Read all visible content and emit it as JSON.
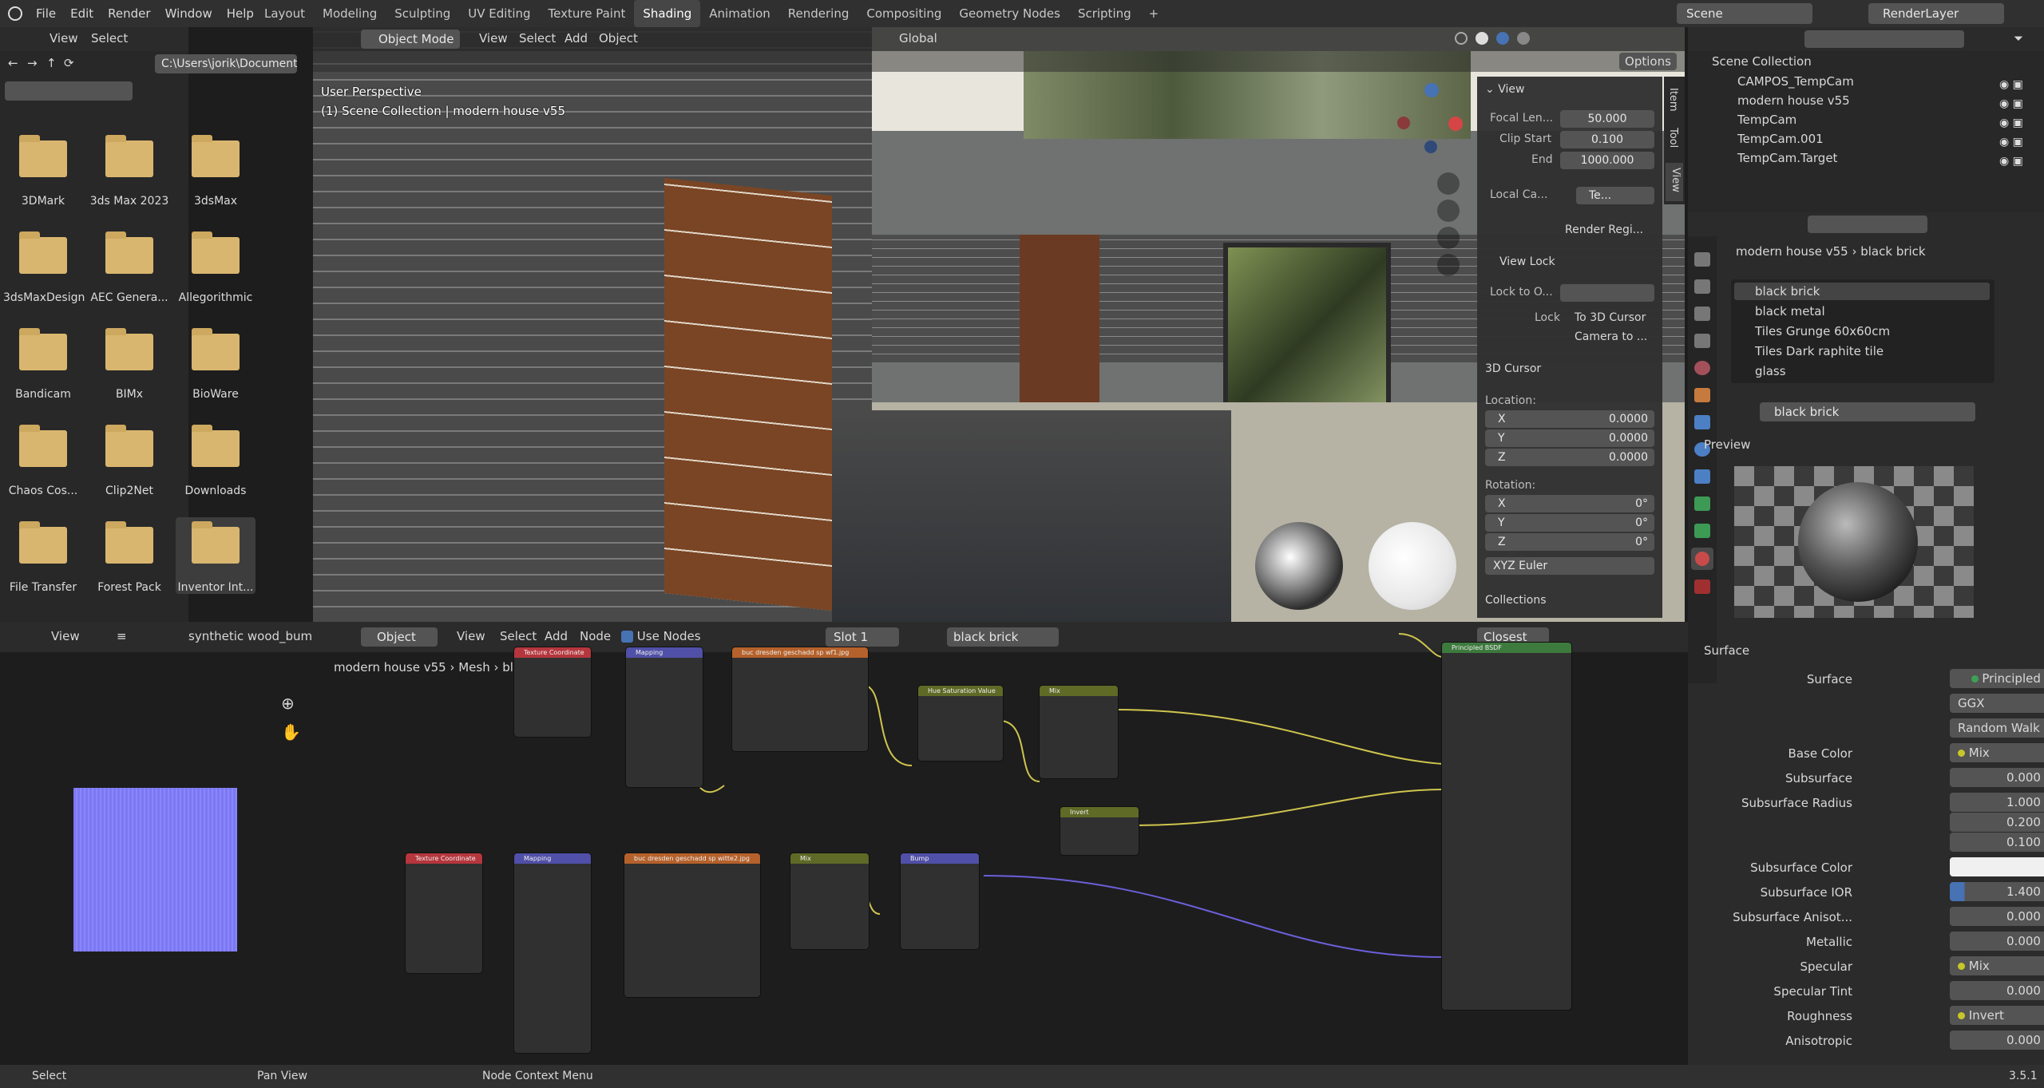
{
  "menubar": {
    "items": [
      "File",
      "Edit",
      "Render",
      "Window",
      "Help"
    ],
    "workspaces": [
      "Layout",
      "Modeling",
      "Sculpting",
      "UV Editing",
      "Texture Paint",
      "Shading",
      "Animation",
      "Rendering",
      "Compositing",
      "Geometry Nodes",
      "Scripting"
    ],
    "active_workspace": "Shading",
    "add": "+",
    "scene": "Scene",
    "view_layer": "RenderLayer"
  },
  "filebrowser": {
    "menu": [
      "View",
      "Select"
    ],
    "path": "C:\\Users\\jorik\\Documents\\",
    "folders": [
      "3DMark",
      "3ds Max 2023",
      "3dsMax",
      "3dsMaxDesign",
      "AEC Genera...",
      "Allegorithmic",
      "Bandicam",
      "BIMx",
      "BioWare",
      "Chaos Cos...",
      "Clip2Net",
      "Downloads",
      "File Transfer",
      "Forest Pack",
      "Inventor Int..."
    ]
  },
  "viewport": {
    "mode": "Object Mode",
    "menu": [
      "View",
      "Select",
      "Add",
      "Object"
    ],
    "transform": "Global",
    "options": "Options",
    "overlay_line1": "User Perspective",
    "overlay_line2": "(1) Scene Collection | modern house v55"
  },
  "npanel": {
    "tabs": [
      "Item",
      "Tool",
      "View"
    ],
    "view_title": "View",
    "focal_label": "Focal Len...",
    "focal": "50.000",
    "clip_start_label": "Clip Start",
    "clip_start": "0.100",
    "end_label": "End",
    "end": "1000.000",
    "local_cam": "Local Ca...",
    "local_cam_field": "Te...",
    "render_region": "Render Regi...",
    "view_lock": "View Lock",
    "lock_to": "Lock to O...",
    "lock": "Lock",
    "to_3d_cursor": "To 3D Cursor",
    "camera_to": "Camera to ...",
    "cursor_title": "3D Cursor",
    "location": "Location:",
    "loc": [
      [
        "X",
        "0.0000"
      ],
      [
        "Y",
        "0.0000"
      ],
      [
        "Z",
        "0.0000"
      ]
    ],
    "rotation": "Rotation:",
    "rot": [
      [
        "X",
        "0°"
      ],
      [
        "Y",
        "0°"
      ],
      [
        "Z",
        "0°"
      ]
    ],
    "euler": "XYZ Euler",
    "collections": "Collections"
  },
  "outliner": {
    "root": "Scene Collection",
    "items": [
      "CAMPOS_TempCam",
      "modern house v55",
      "TempCam",
      "TempCam.001",
      "TempCam.Target"
    ]
  },
  "properties": {
    "breadcrumb_obj": "modern house v55",
    "breadcrumb_mat": "black brick",
    "materials": [
      "black brick",
      "black metal",
      "Tiles Grunge 60x60cm",
      "Tiles Dark raphite tile",
      "glass"
    ],
    "material_name": "black brick",
    "preview": "Preview",
    "surface_panel": "Surface",
    "rows": [
      [
        "Surface",
        "Principled BSDF"
      ],
      [
        "",
        "GGX"
      ],
      [
        "",
        "Random Walk"
      ],
      [
        "Base Color",
        "Mix"
      ],
      [
        "Subsurface",
        "0.000"
      ],
      [
        "Subsurface Radius",
        "1.000"
      ],
      [
        "",
        "0.200"
      ],
      [
        "",
        "0.100"
      ],
      [
        "Subsurface Color",
        ""
      ],
      [
        "Subsurface IOR",
        "1.400"
      ],
      [
        "Subsurface Anisot...",
        "0.000"
      ],
      [
        "Metallic",
        "0.000"
      ],
      [
        "Specular",
        "Mix"
      ],
      [
        "Specular Tint",
        "0.000"
      ],
      [
        "Roughness",
        "Invert"
      ],
      [
        "Anisotropic",
        "0.000"
      ]
    ]
  },
  "image_editor": {
    "menu": [
      "View"
    ],
    "image": "synthetic wood_bump.p"
  },
  "node_editor": {
    "type": "Object",
    "menu": [
      "View",
      "Select",
      "Add",
      "Node"
    ],
    "use_nodes": "Use Nodes",
    "slot": "Slot 1",
    "material": "black brick",
    "breadcrumb": [
      "modern house v55",
      "Mesh",
      "black brick"
    ],
    "interp": "Closest",
    "nodes": {
      "texcoord": "Texture Coordinate",
      "mapping": "Mapping",
      "img1": "buc dresden geschadd sp wf1.jpg",
      "img2": "buc dresden geschadd sp witte2.jpg",
      "hue": "Hue Saturation Value",
      "mix": "Mix",
      "invert": "Invert",
      "bump": "Bump",
      "principled": "Principled BSDF"
    }
  },
  "statusbar": {
    "select": "Select",
    "pan": "Pan View",
    "ctx": "Node Context Menu",
    "version": "3.5.1"
  },
  "colors": {
    "accent": "#4772b3",
    "header": "#303030",
    "bg": "#1d1d1d",
    "field": "#545454"
  }
}
